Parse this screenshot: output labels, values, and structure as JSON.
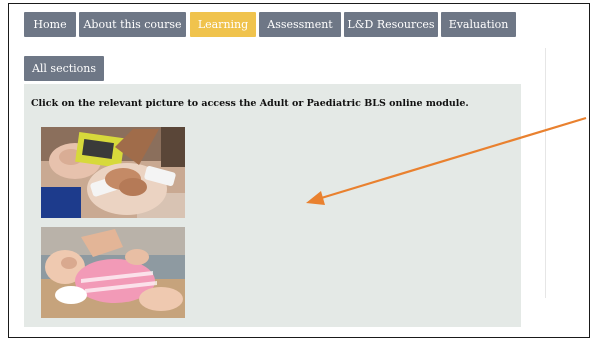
{
  "nav": {
    "tabs": [
      {
        "label": "Home",
        "active": false
      },
      {
        "label": "About this course",
        "active": false
      },
      {
        "label": "Learning",
        "active": true
      },
      {
        "label": "Assessment",
        "active": false
      },
      {
        "label": "L&D Resources",
        "active": false
      },
      {
        "label": "Evaluation",
        "active": false
      }
    ],
    "secondary": {
      "label": "All sections"
    }
  },
  "content": {
    "instruction": "Click on the relevant picture to access the Adult or Paediatric BLS online module.",
    "images": [
      {
        "subject": "adult-bls-manikin-cpr"
      },
      {
        "subject": "paediatric-bls-manikin"
      }
    ]
  },
  "annotation": {
    "arrow_color": "#e9812f"
  },
  "colors": {
    "tab": "#6e7786",
    "tab_active": "#f0c34d",
    "panel": "#e4e9e6"
  }
}
